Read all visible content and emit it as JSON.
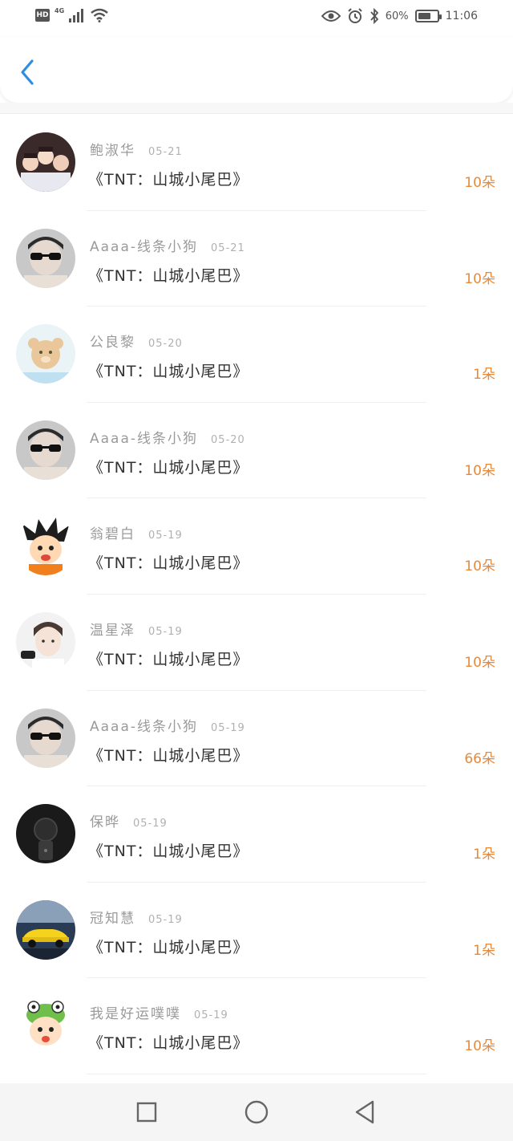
{
  "status_bar": {
    "hd": "HD",
    "network": "4G",
    "battery_text": "60%",
    "battery_level": 0.6,
    "time": "11:06",
    "icons": [
      "signal-icon",
      "wifi-icon",
      "eye-icon",
      "alarm-icon",
      "bluetooth-icon",
      "battery-icon"
    ]
  },
  "header": {
    "back_icon": "chevron-left-icon",
    "accent": "#2e8fe0"
  },
  "gifts": [
    {
      "user": "鲍淑华",
      "date": "05-21",
      "title": "《TNT：山城小尾巴》",
      "count": "10朵",
      "avatar": "group-photo"
    },
    {
      "user": "Aaaa-线条小狗",
      "date": "05-21",
      "title": "《TNT：山城小尾巴》",
      "count": "10朵",
      "avatar": "sunglasses-boy"
    },
    {
      "user": "公良黎",
      "date": "05-20",
      "title": "《TNT：山城小尾巴》",
      "count": "1朵",
      "avatar": "teddy-bear"
    },
    {
      "user": "Aaaa-线条小狗",
      "date": "05-20",
      "title": "《TNT：山城小尾巴》",
      "count": "10朵",
      "avatar": "sunglasses-boy"
    },
    {
      "user": "翁碧白",
      "date": "05-19",
      "title": "《TNT：山城小尾巴》",
      "count": "10朵",
      "avatar": "cartoon-goku"
    },
    {
      "user": "温星泽",
      "date": "05-19",
      "title": "《TNT：山城小尾巴》",
      "count": "10朵",
      "avatar": "idol-portrait"
    },
    {
      "user": "Aaaa-线条小狗",
      "date": "05-19",
      "title": "《TNT：山城小尾巴》",
      "count": "66朵",
      "avatar": "sunglasses-boy"
    },
    {
      "user": "保晔",
      "date": "05-19",
      "title": "《TNT：山城小尾巴》",
      "count": "1朵",
      "avatar": "dark-selfie"
    },
    {
      "user": "冠知慧",
      "date": "05-19",
      "title": "《TNT：山城小尾巴》",
      "count": "1朵",
      "avatar": "yellow-car"
    },
    {
      "user": "我是好运噗噗",
      "date": "05-19",
      "title": "《TNT：山城小尾巴》",
      "count": "10朵",
      "avatar": "cartoon-frog-kid"
    }
  ],
  "colors": {
    "count": "#e58a3c",
    "accent": "#2e8fe0"
  },
  "nav": {
    "icons": [
      "recent-apps-icon",
      "home-icon",
      "back-icon"
    ]
  }
}
